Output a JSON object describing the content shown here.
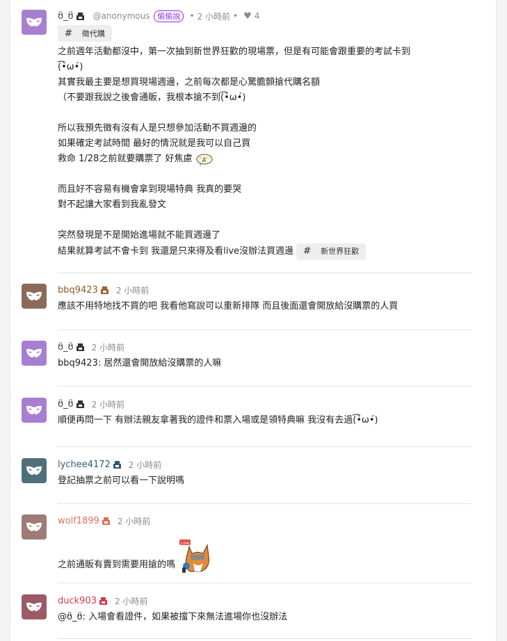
{
  "post": {
    "author": "ʊ̈_ʊ̈",
    "handle": "@anonymous",
    "badge": "偷偷說",
    "time": "2 小時前",
    "likes": "4",
    "tag": "徵代購",
    "lines": [
      "之前週年活動都沒中，第一次抽到新世界狂歡的現場票，但是有可能會跟重要的考試卡到",
      "(͡•̀ω•́)",
      "其實我最主要是想買現場週邊，之前每次都是心驚膽顫搶代購名額",
      "（不要跟我說之後會通販，我根本搶不到(͡•̀ω•́)",
      "",
      "所以我預先徵有沒有人是只想參加活動不買週邊的",
      "如果確定考試時間 最好的情況就是我可以自己買",
      "救命 1/28之前就要購票了 好焦慮",
      "",
      "而且好不容易有機會拿到現場特典 我真的要哭",
      "對不起讓大家看到我亂發文",
      "",
      "突然發現是不是開始進場就不能買週邊了",
      "結果就算考試不會卡到 我還是只來得及看live沒辦法買週邊"
    ],
    "inline_tag": "新世界狂歡",
    "colors": {
      "avatar": "#a77fd0",
      "badge": "#8a2be2"
    }
  },
  "comments": [
    {
      "author": "bbq9423",
      "time": "2 小時前",
      "text": "應該不用特地找不買的吧 我看他寫說可以重新排隊 而且後面還會開放給沒購票的人買",
      "name_color": "#8b5a2b",
      "avatar_color": "#8b6b58"
    },
    {
      "author": "ʊ̈_ʊ̈",
      "time": "2 小時前",
      "text": "bbq9423: 居然還會開放給沒購票的人嘛",
      "name_color": "#3a3a3a",
      "avatar_color": "#a77fd0"
    },
    {
      "author": "ʊ̈_ʊ̈",
      "time": "2 小時前",
      "text": "順便再問一下 有辦法親友拿著我的證件和票入場或是領特典嘛 我沒有去過(͡•̀ω•́)",
      "name_color": "#3a3a3a",
      "avatar_color": "#a77fd0"
    },
    {
      "author": "lychee4172",
      "time": "2 小時前",
      "text": "登記抽票之前可以看一下說明嗎",
      "name_color": "#2f5b73",
      "avatar_color": "#4f6f7a"
    },
    {
      "author": "wolf1899",
      "time": "2 小時前",
      "text": "之前通販有賣到需要用搶的嗎",
      "name_color": "#e0705a",
      "avatar_color": "#9e7b76",
      "sticker_label": "Live"
    },
    {
      "author": "duck903",
      "time": "2 小時前",
      "text": "@ʊ̈_ʊ̈: 入場會看證件，如果被擋下來無法進場你也沒辦法",
      "name_color": "#d23c4c",
      "avatar_color": "#9c5a66"
    }
  ]
}
